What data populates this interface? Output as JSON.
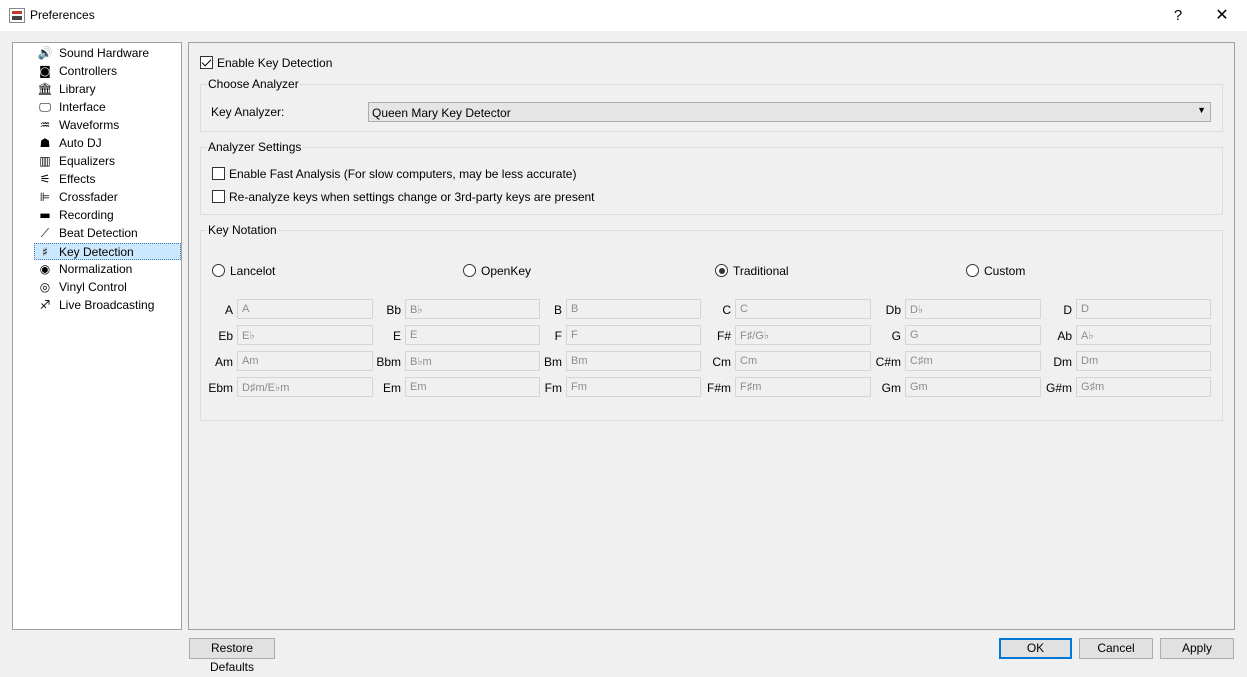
{
  "window": {
    "title": "Preferences",
    "help_glyph": "?",
    "close_glyph": "✕"
  },
  "sidebar": {
    "items": [
      {
        "label": "Sound Hardware",
        "icon": "speaker-icon",
        "glyph": "🔊"
      },
      {
        "label": "Controllers",
        "icon": "controller-icon",
        "glyph": "◙"
      },
      {
        "label": "Library",
        "icon": "library-icon",
        "glyph": "🏛"
      },
      {
        "label": "Interface",
        "icon": "monitor-icon",
        "glyph": "🖵"
      },
      {
        "label": "Waveforms",
        "icon": "waveform-icon",
        "glyph": "♒"
      },
      {
        "label": "Auto DJ",
        "icon": "robot-icon",
        "glyph": "☗"
      },
      {
        "label": "Equalizers",
        "icon": "equalizer-icon",
        "glyph": "▥"
      },
      {
        "label": "Effects",
        "icon": "effects-icon",
        "glyph": "⚟"
      },
      {
        "label": "Crossfader",
        "icon": "crossfader-icon",
        "glyph": "⊫"
      },
      {
        "label": "Recording",
        "icon": "recording-icon",
        "glyph": "▬"
      },
      {
        "label": "Beat Detection",
        "icon": "beat-detection-icon",
        "glyph": "⟋"
      },
      {
        "label": "Key Detection",
        "icon": "key-detection-icon",
        "glyph": "♯"
      },
      {
        "label": "Normalization",
        "icon": "normalization-icon",
        "glyph": "◉"
      },
      {
        "label": "Vinyl Control",
        "icon": "vinyl-icon",
        "glyph": "◎"
      },
      {
        "label": "Live Broadcasting",
        "icon": "broadcast-icon",
        "glyph": "♐"
      }
    ],
    "selected": "Key Detection"
  },
  "key_detection": {
    "enable_label": "Enable Key Detection",
    "enable_checked": true,
    "choose_analyzer_title": "Choose Analyzer",
    "key_analyzer_label": "Key Analyzer:",
    "key_analyzer_value": "Queen Mary Key Detector",
    "dropdown_arrow": "▼",
    "analyzer_settings_title": "Analyzer Settings",
    "fast_analysis_label": "Enable Fast Analysis (For slow computers, may be less accurate)",
    "fast_analysis_checked": false,
    "reanalyze_label": "Re-analyze keys when settings change or 3rd-party keys are present",
    "reanalyze_checked": false,
    "notation_title": "Key Notation",
    "notation_options": [
      {
        "label": "Lancelot",
        "checked": false
      },
      {
        "label": "OpenKey",
        "checked": false
      },
      {
        "label": "Traditional",
        "checked": true
      },
      {
        "label": "Custom",
        "checked": false
      }
    ],
    "keys": [
      [
        {
          "key": "A",
          "value": "A"
        },
        {
          "key": "Bb",
          "value": "B♭"
        },
        {
          "key": "B",
          "value": "B"
        },
        {
          "key": "C",
          "value": "C"
        },
        {
          "key": "Db",
          "value": "D♭"
        },
        {
          "key": "D",
          "value": "D"
        }
      ],
      [
        {
          "key": "Eb",
          "value": "E♭"
        },
        {
          "key": "E",
          "value": "E"
        },
        {
          "key": "F",
          "value": "F"
        },
        {
          "key": "F#",
          "value": "F♯/G♭"
        },
        {
          "key": "G",
          "value": "G"
        },
        {
          "key": "Ab",
          "value": "A♭"
        }
      ],
      [
        {
          "key": "Am",
          "value": "Am"
        },
        {
          "key": "Bbm",
          "value": "B♭m"
        },
        {
          "key": "Bm",
          "value": "Bm"
        },
        {
          "key": "Cm",
          "value": "Cm"
        },
        {
          "key": "C#m",
          "value": "C♯m"
        },
        {
          "key": "Dm",
          "value": "Dm"
        }
      ],
      [
        {
          "key": "Ebm",
          "value": "D♯m/E♭m"
        },
        {
          "key": "Em",
          "value": "Em"
        },
        {
          "key": "Fm",
          "value": "Fm"
        },
        {
          "key": "F#m",
          "value": "F♯m"
        },
        {
          "key": "Gm",
          "value": "Gm"
        },
        {
          "key": "G#m",
          "value": "G♯m"
        }
      ]
    ]
  },
  "footer": {
    "restore_defaults": "Restore Defaults",
    "ok": "OK",
    "cancel": "Cancel",
    "apply": "Apply"
  }
}
